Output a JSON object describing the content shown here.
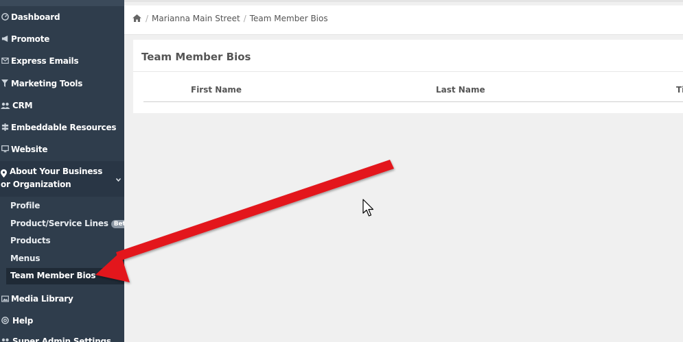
{
  "sidebar": {
    "items": [
      {
        "label": "Dashboard",
        "icon": "dashboard-icon"
      },
      {
        "label": "Promote",
        "icon": "bullhorn-icon"
      },
      {
        "label": "Express Emails",
        "icon": "envelope-icon"
      },
      {
        "label": "Marketing Tools",
        "icon": "filter-icon"
      },
      {
        "label": "CRM",
        "icon": "users-icon"
      },
      {
        "label": "Embeddable Resources",
        "icon": "signpost-icon"
      },
      {
        "label": "Website",
        "icon": "monitor-icon"
      }
    ],
    "group": {
      "label": "About Your Business or Organization",
      "icon": "map-marker-icon",
      "sub_items": [
        {
          "label": "Profile"
        },
        {
          "label": "Product/Service Lines",
          "badge": "Beta"
        },
        {
          "label": "Products"
        },
        {
          "label": "Menus"
        },
        {
          "label": "Team Member Bios",
          "active": true
        }
      ]
    },
    "bottom_items": [
      {
        "label": "Media Library",
        "icon": "image-icon"
      },
      {
        "label": "Help",
        "icon": "lifebuoy-icon"
      },
      {
        "label": "Super Admin Settings",
        "icon": "users-cog-icon"
      }
    ]
  },
  "breadcrumb": {
    "items": [
      "Marianna Main Street",
      "Team Member Bios"
    ],
    "separator": "/"
  },
  "card": {
    "title": "Team Member Bios",
    "columns": [
      "First Name",
      "Last Name",
      "Ti"
    ]
  },
  "colors": {
    "sidebar_bg": "#2f3d4c",
    "annotation_arrow": "#e3141b"
  }
}
